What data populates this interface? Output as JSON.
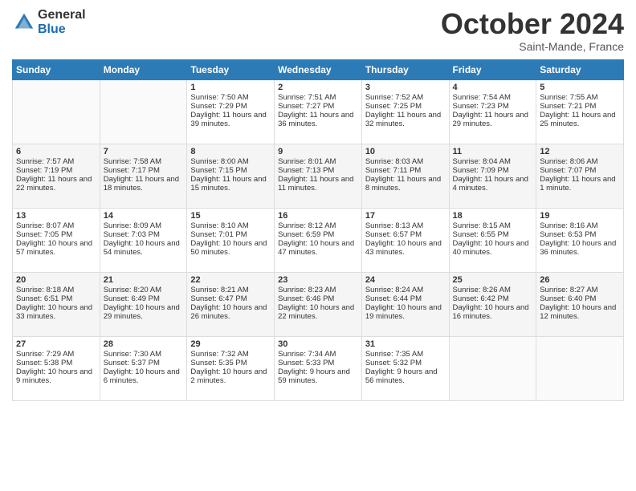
{
  "header": {
    "logo_general": "General",
    "logo_blue": "Blue",
    "month_title": "October 2024",
    "location": "Saint-Mande, France"
  },
  "days_of_week": [
    "Sunday",
    "Monday",
    "Tuesday",
    "Wednesday",
    "Thursday",
    "Friday",
    "Saturday"
  ],
  "weeks": [
    [
      {
        "day": "",
        "sunrise": "",
        "sunset": "",
        "daylight": ""
      },
      {
        "day": "",
        "sunrise": "",
        "sunset": "",
        "daylight": ""
      },
      {
        "day": "1",
        "sunrise": "Sunrise: 7:50 AM",
        "sunset": "Sunset: 7:29 PM",
        "daylight": "Daylight: 11 hours and 39 minutes."
      },
      {
        "day": "2",
        "sunrise": "Sunrise: 7:51 AM",
        "sunset": "Sunset: 7:27 PM",
        "daylight": "Daylight: 11 hours and 36 minutes."
      },
      {
        "day": "3",
        "sunrise": "Sunrise: 7:52 AM",
        "sunset": "Sunset: 7:25 PM",
        "daylight": "Daylight: 11 hours and 32 minutes."
      },
      {
        "day": "4",
        "sunrise": "Sunrise: 7:54 AM",
        "sunset": "Sunset: 7:23 PM",
        "daylight": "Daylight: 11 hours and 29 minutes."
      },
      {
        "day": "5",
        "sunrise": "Sunrise: 7:55 AM",
        "sunset": "Sunset: 7:21 PM",
        "daylight": "Daylight: 11 hours and 25 minutes."
      }
    ],
    [
      {
        "day": "6",
        "sunrise": "Sunrise: 7:57 AM",
        "sunset": "Sunset: 7:19 PM",
        "daylight": "Daylight: 11 hours and 22 minutes."
      },
      {
        "day": "7",
        "sunrise": "Sunrise: 7:58 AM",
        "sunset": "Sunset: 7:17 PM",
        "daylight": "Daylight: 11 hours and 18 minutes."
      },
      {
        "day": "8",
        "sunrise": "Sunrise: 8:00 AM",
        "sunset": "Sunset: 7:15 PM",
        "daylight": "Daylight: 11 hours and 15 minutes."
      },
      {
        "day": "9",
        "sunrise": "Sunrise: 8:01 AM",
        "sunset": "Sunset: 7:13 PM",
        "daylight": "Daylight: 11 hours and 11 minutes."
      },
      {
        "day": "10",
        "sunrise": "Sunrise: 8:03 AM",
        "sunset": "Sunset: 7:11 PM",
        "daylight": "Daylight: 11 hours and 8 minutes."
      },
      {
        "day": "11",
        "sunrise": "Sunrise: 8:04 AM",
        "sunset": "Sunset: 7:09 PM",
        "daylight": "Daylight: 11 hours and 4 minutes."
      },
      {
        "day": "12",
        "sunrise": "Sunrise: 8:06 AM",
        "sunset": "Sunset: 7:07 PM",
        "daylight": "Daylight: 11 hours and 1 minute."
      }
    ],
    [
      {
        "day": "13",
        "sunrise": "Sunrise: 8:07 AM",
        "sunset": "Sunset: 7:05 PM",
        "daylight": "Daylight: 10 hours and 57 minutes."
      },
      {
        "day": "14",
        "sunrise": "Sunrise: 8:09 AM",
        "sunset": "Sunset: 7:03 PM",
        "daylight": "Daylight: 10 hours and 54 minutes."
      },
      {
        "day": "15",
        "sunrise": "Sunrise: 8:10 AM",
        "sunset": "Sunset: 7:01 PM",
        "daylight": "Daylight: 10 hours and 50 minutes."
      },
      {
        "day": "16",
        "sunrise": "Sunrise: 8:12 AM",
        "sunset": "Sunset: 6:59 PM",
        "daylight": "Daylight: 10 hours and 47 minutes."
      },
      {
        "day": "17",
        "sunrise": "Sunrise: 8:13 AM",
        "sunset": "Sunset: 6:57 PM",
        "daylight": "Daylight: 10 hours and 43 minutes."
      },
      {
        "day": "18",
        "sunrise": "Sunrise: 8:15 AM",
        "sunset": "Sunset: 6:55 PM",
        "daylight": "Daylight: 10 hours and 40 minutes."
      },
      {
        "day": "19",
        "sunrise": "Sunrise: 8:16 AM",
        "sunset": "Sunset: 6:53 PM",
        "daylight": "Daylight: 10 hours and 36 minutes."
      }
    ],
    [
      {
        "day": "20",
        "sunrise": "Sunrise: 8:18 AM",
        "sunset": "Sunset: 6:51 PM",
        "daylight": "Daylight: 10 hours and 33 minutes."
      },
      {
        "day": "21",
        "sunrise": "Sunrise: 8:20 AM",
        "sunset": "Sunset: 6:49 PM",
        "daylight": "Daylight: 10 hours and 29 minutes."
      },
      {
        "day": "22",
        "sunrise": "Sunrise: 8:21 AM",
        "sunset": "Sunset: 6:47 PM",
        "daylight": "Daylight: 10 hours and 26 minutes."
      },
      {
        "day": "23",
        "sunrise": "Sunrise: 8:23 AM",
        "sunset": "Sunset: 6:46 PM",
        "daylight": "Daylight: 10 hours and 22 minutes."
      },
      {
        "day": "24",
        "sunrise": "Sunrise: 8:24 AM",
        "sunset": "Sunset: 6:44 PM",
        "daylight": "Daylight: 10 hours and 19 minutes."
      },
      {
        "day": "25",
        "sunrise": "Sunrise: 8:26 AM",
        "sunset": "Sunset: 6:42 PM",
        "daylight": "Daylight: 10 hours and 16 minutes."
      },
      {
        "day": "26",
        "sunrise": "Sunrise: 8:27 AM",
        "sunset": "Sunset: 6:40 PM",
        "daylight": "Daylight: 10 hours and 12 minutes."
      }
    ],
    [
      {
        "day": "27",
        "sunrise": "Sunrise: 7:29 AM",
        "sunset": "Sunset: 5:38 PM",
        "daylight": "Daylight: 10 hours and 9 minutes."
      },
      {
        "day": "28",
        "sunrise": "Sunrise: 7:30 AM",
        "sunset": "Sunset: 5:37 PM",
        "daylight": "Daylight: 10 hours and 6 minutes."
      },
      {
        "day": "29",
        "sunrise": "Sunrise: 7:32 AM",
        "sunset": "Sunset: 5:35 PM",
        "daylight": "Daylight: 10 hours and 2 minutes."
      },
      {
        "day": "30",
        "sunrise": "Sunrise: 7:34 AM",
        "sunset": "Sunset: 5:33 PM",
        "daylight": "Daylight: 9 hours and 59 minutes."
      },
      {
        "day": "31",
        "sunrise": "Sunrise: 7:35 AM",
        "sunset": "Sunset: 5:32 PM",
        "daylight": "Daylight: 9 hours and 56 minutes."
      },
      {
        "day": "",
        "sunrise": "",
        "sunset": "",
        "daylight": ""
      },
      {
        "day": "",
        "sunrise": "",
        "sunset": "",
        "daylight": ""
      }
    ]
  ]
}
